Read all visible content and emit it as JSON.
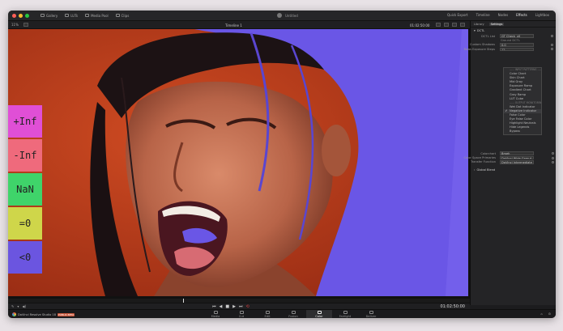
{
  "app": {
    "title": "Untitled",
    "brand": "DaVinci Resolve Studio 18",
    "beta_badge": "PUBLIC BETA"
  },
  "top_nav": [
    "Gallery",
    "LUTs",
    "Media Pool",
    "Clips"
  ],
  "right_tabs": [
    {
      "label": "Quick Export",
      "active": false
    },
    {
      "label": "Timeline",
      "active": false
    },
    {
      "label": "Nodes",
      "active": false
    },
    {
      "label": "Effects",
      "active": true
    },
    {
      "label": "Lightbox",
      "active": false
    }
  ],
  "toolbar": {
    "zoom": "11%",
    "timeline_name": "Timeline 1",
    "timecode": "01:02:50:00"
  },
  "panel": {
    "tabs": [
      {
        "label": "Library",
        "active": false
      },
      {
        "label": "Settings",
        "active": true
      }
    ],
    "section": "DCTL",
    "rows": [
      {
        "label": "DCTL List",
        "value": "GT Check_v0"
      },
      {
        "label": "",
        "value": "Ground DCTL"
      },
      {
        "label": "Custom Shadows",
        "value": "0.0"
      },
      {
        "label": "Rows Exposure Steps",
        "value": "12"
      }
    ],
    "dropdown_items": [
      {
        "label": "----- INPUT PATTERNS -----",
        "sep": true,
        "checked": false
      },
      {
        "label": "Color Chart",
        "sep": false,
        "checked": false
      },
      {
        "label": "Skin Chart",
        "sep": false,
        "checked": false
      },
      {
        "label": "Mid Gray",
        "sep": false,
        "checked": false
      },
      {
        "label": "Exposure Ramp",
        "sep": false,
        "checked": false
      },
      {
        "label": "Gradient Chart",
        "sep": false,
        "checked": false
      },
      {
        "label": "Gray Ramp",
        "sep": false,
        "checked": false
      },
      {
        "label": "LUT Cube",
        "sep": false,
        "checked": false
      },
      {
        "label": "----- OUTPUT MONITORING -----",
        "sep": true,
        "checked": false
      },
      {
        "label": "Wet Dot Indicator",
        "sep": false,
        "checked": false
      },
      {
        "label": "Negative Indicator",
        "sep": false,
        "checked": true
      },
      {
        "label": "False Color",
        "sep": false,
        "checked": false
      },
      {
        "label": "Eye False Color",
        "sep": false,
        "checked": false
      },
      {
        "label": "Highlight Neutrals",
        "sep": false,
        "checked": false
      },
      {
        "label": "Hide Legends",
        "sep": false,
        "checked": false
      },
      {
        "label": "Bypass",
        "sep": false,
        "checked": false
      }
    ],
    "lower_rows": [
      {
        "label": "Colorchart",
        "value": "Bmeh"
      },
      {
        "label": "Color Space Primaries",
        "value": "DaVinci Wide Gamut"
      },
      {
        "label": "Transfer Function",
        "value": "DaVinci Intermediate"
      }
    ],
    "global_blend": "Global Blend"
  },
  "badges": [
    {
      "label": "+Inf",
      "color": "#e04fd6"
    },
    {
      "label": "-Inf",
      "color": "#ef6a7c"
    },
    {
      "label": "NaN",
      "color": "#3fd46a"
    },
    {
      "label": "=0",
      "color": "#cfd64a"
    },
    {
      "label": "<0",
      "color": "#6b55e0"
    }
  ],
  "transport": {
    "timecode": "01:02:50:00"
  },
  "pages": [
    {
      "label": "Media",
      "active": false
    },
    {
      "label": "Cut",
      "active": false
    },
    {
      "label": "Edit",
      "active": false
    },
    {
      "label": "Fusion",
      "active": false
    },
    {
      "label": "Color",
      "active": true
    },
    {
      "label": "Fairlight",
      "active": false
    },
    {
      "label": "Deliver",
      "active": false
    }
  ]
}
